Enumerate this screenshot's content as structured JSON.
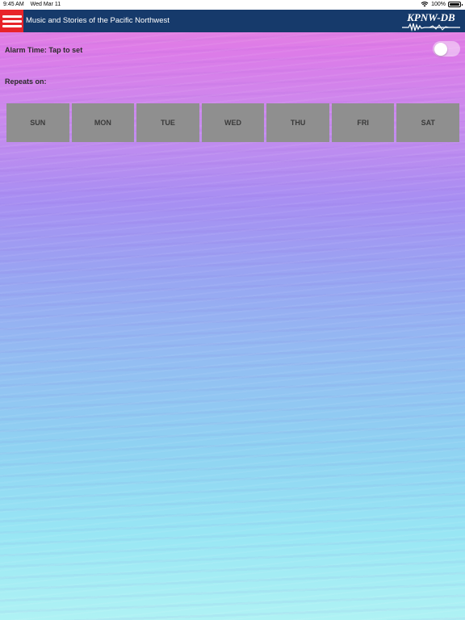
{
  "status_bar": {
    "time": "9:45 AM",
    "date": "Wed Mar 11",
    "battery": "100%",
    "battery_level": 1.0
  },
  "nav": {
    "title": "Music and Stories of the Pacific Northwest",
    "logo_text": "KPNW-DB",
    "menu_icon": "hamburger-menu-icon"
  },
  "alarm": {
    "label": "Alarm Time: Tap to set",
    "enabled": false
  },
  "repeats": {
    "label": "Repeats on:",
    "days": [
      "SUN",
      "MON",
      "TUE",
      "WED",
      "THU",
      "FRI",
      "SAT"
    ]
  },
  "colors": {
    "nav_background": "#163a6b",
    "menu_button": "#e8242a",
    "day_button": "#8f8f8f"
  }
}
